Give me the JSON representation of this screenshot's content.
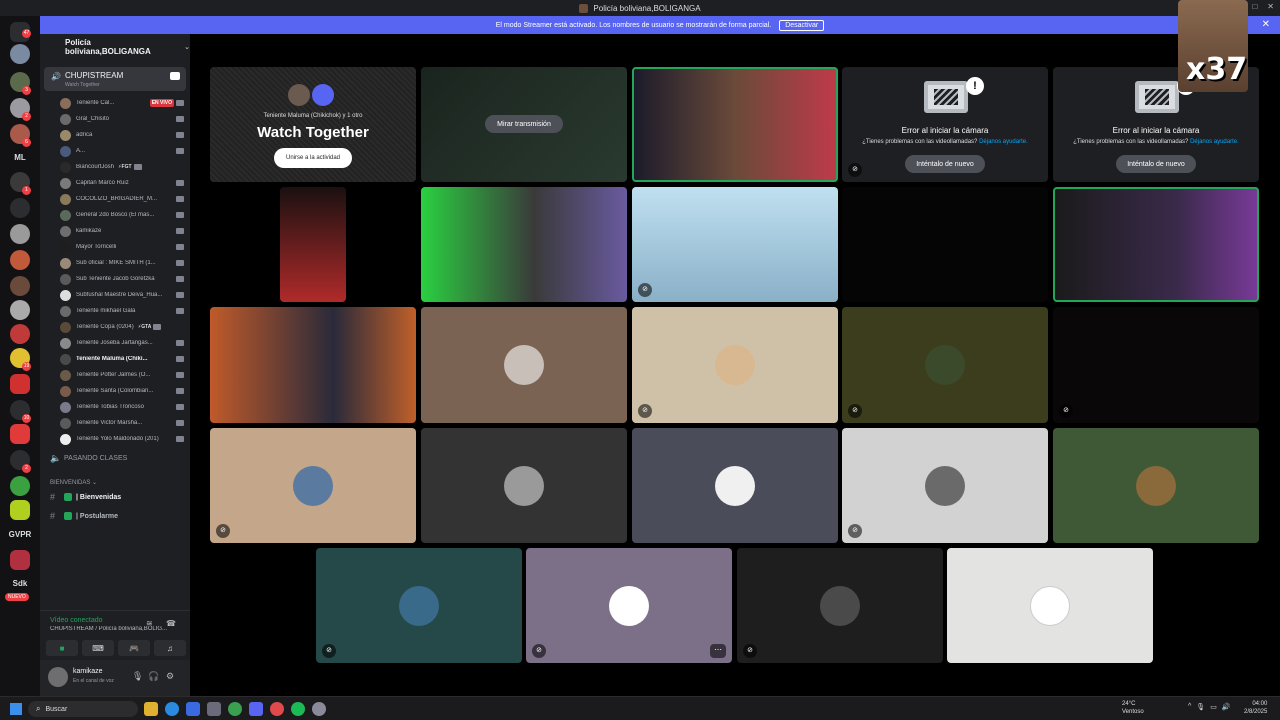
{
  "window": {
    "title": "Policía boliviana,BOLIGANGA",
    "controls": [
      "–",
      "□",
      "✕"
    ]
  },
  "banner": {
    "text": "El modo Streamer está activado. Los nombres de usuario se mostrarán de forma parcial.",
    "button": "Desactivar",
    "close": "✕"
  },
  "rail": {
    "badges": [
      "47",
      "3",
      "2",
      "6",
      "1",
      "19",
      "10",
      "2",
      "7",
      "3",
      "16",
      "2",
      "19",
      "1"
    ],
    "text_items": [
      "ML",
      "GVPR",
      "Sdk"
    ],
    "nuevo": "NUEVO"
  },
  "sidebar": {
    "server_name": "Policía boliviana,BOLIGANGA",
    "voice_channel": {
      "name": "CHUPISTREAM",
      "subtitle": "Watch Together"
    },
    "users": [
      {
        "name": "Teniente Cal...",
        "live": "EN VIVO",
        "color": "#8a6d5a"
      },
      {
        "name": "Gral_Chisito",
        "color": "#6a6a6a"
      },
      {
        "name": "adrica",
        "color": "#9a8a6a"
      },
      {
        "name": "A...",
        "color": "#4a5a7a"
      },
      {
        "name": "BiancourtJosh",
        "tag": "⚡FGT",
        "color": "#2a2a2a"
      },
      {
        "name": "Capitan Marco Ruiz",
        "color": "#7a7a7a"
      },
      {
        "name": "COCOLIZO_BRIGADIER_M...",
        "color": "#8a7a5a"
      },
      {
        "name": "General 2do Bosco (El mas...",
        "color": "#5a6a5a"
      },
      {
        "name": "kamikaze",
        "color": "#6e6e6e"
      },
      {
        "name": "Mayor Torricelli",
        "color": "#1e1e1e"
      },
      {
        "name": "Sub oficial : MIKE SMITH (1...",
        "color": "#9a8a7a"
      },
      {
        "name": "Sub Teniente Jacob Goretzka",
        "color": "#5a5a5a"
      },
      {
        "name": "Subfushal Maestre Deiva_Hua...",
        "color": "#dddddd"
      },
      {
        "name": "Teniente mikhael Gala",
        "color": "#6a6a6a"
      },
      {
        "name": "Teniente Copa (0204)",
        "tag": "⚡GTA",
        "color": "#5a4a3a"
      },
      {
        "name": "Teniente Joseba Jartangas...",
        "color": "#8a8a8a"
      },
      {
        "name": "Teniente Maluma (Chiki...",
        "color": "#4a4a4a",
        "bold": true
      },
      {
        "name": "Teniente Potter Jalmes (O...",
        "color": "#6a5a4a"
      },
      {
        "name": "Teniente Santa (Colombian...",
        "color": "#7a5a4a"
      },
      {
        "name": "Teniente Tobias Troncoso",
        "color": "#7a7a8a"
      },
      {
        "name": "Teniente Victor Marsha...",
        "color": "#5a5a5a"
      },
      {
        "name": "Teniente Yolo Maldonado (201)",
        "color": "#eeeeee"
      }
    ],
    "voice_channel_2": "PASANDO CLASES",
    "category": "BIENVENIDAS",
    "text_channels": [
      "| Bienvenidas",
      "| Postularme"
    ]
  },
  "voice_panel": {
    "status": "Vídeo conectado",
    "path": "CHUPISTREAM / Policía boliviana,BOLIG...",
    "controls": [
      "■",
      "⌨",
      "🎮",
      "♫"
    ]
  },
  "user_panel": {
    "name": "kamikaze",
    "status": "En el canal de voz"
  },
  "tiles": {
    "watch_together": {
      "subtitle": "Teniente Maluma (Chikichok) y 1 otro",
      "title": "Watch Together",
      "button": "Unirse a la actividad"
    },
    "screen_share": {
      "button": "Mirar transmisión"
    },
    "camera_error": {
      "title": "Error al iniciar la cámara",
      "text": "¿Tienes problemas con las videollamadas?",
      "link": "Déjanos ayudarte.",
      "retry": "Inténtalo de nuevo"
    }
  },
  "overlay": {
    "count": "x37"
  },
  "taskbar": {
    "search": "Buscar",
    "weather_temp": "24°C",
    "weather_desc": "Ventoso",
    "time": "04:00",
    "date": "2/8/2025"
  },
  "colors": {
    "accent": "#5865f2",
    "speaking": "#23a55a",
    "live": "#da373c"
  }
}
